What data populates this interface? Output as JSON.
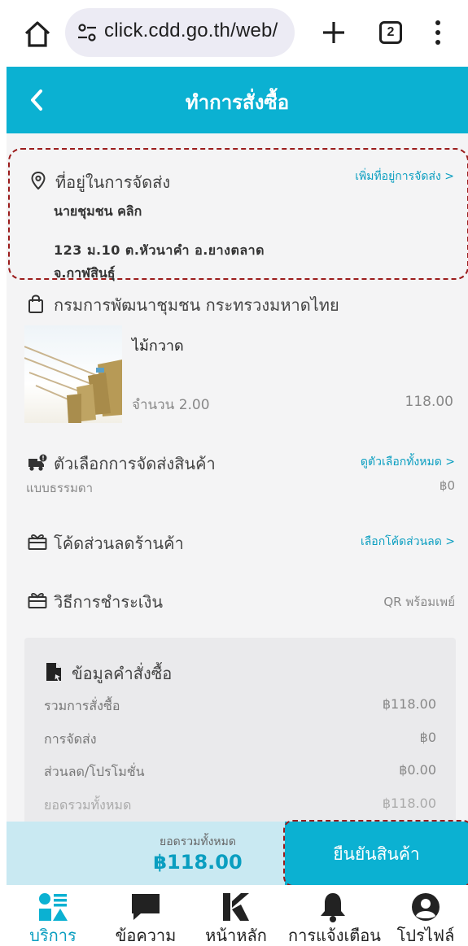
{
  "browser": {
    "url": "click.cdd.go.th/web/",
    "tab_count": "2"
  },
  "header": {
    "title": "ทำการสั่งซื้อ"
  },
  "address": {
    "label": "ที่อยู่ในการจัดส่ง",
    "add_link": "เพิ่มที่อยู่การจัดส่ง >",
    "recipient": "นายชุมชน คลิก",
    "line1": "123 ม.10 ต.หัวนาคำ อ.ยางตลาด",
    "line2": "จ.กาฬสินธุ์"
  },
  "shop": {
    "name": "กรมการพัฒนาชุมชน กระทรวงมหาดไทย"
  },
  "product": {
    "name": "ไม้กวาด",
    "quantity": "จำนวน 2.00",
    "price": "118.00"
  },
  "shipping": {
    "label": "ตัวเลือกการจัดส่งสินค้า",
    "link": "ดูตัวเลือกทั้งหมด >",
    "method": "แบบธรรมดา",
    "cost": "฿0"
  },
  "coupon": {
    "label": "โค้ดส่วนลดร้านค้า",
    "link": "เลือกโค้ดส่วนลด >"
  },
  "payment": {
    "label": "วิธีการชำระเงิน",
    "value": "QR พร้อมเพย์"
  },
  "summary": {
    "title": "ข้อมูลคำสั่งซื้อ",
    "rows": [
      {
        "label": "รวมการสั่งซื้อ",
        "value": "฿118.00"
      },
      {
        "label": "การจัดส่ง",
        "value": "฿0"
      },
      {
        "label": "ส่วนลด/โปรโมชั่น",
        "value": "฿0.00"
      },
      {
        "label": "ยอดรวมทั้งหมด",
        "value": "฿118.00"
      }
    ]
  },
  "checkout": {
    "total_label": "ยอดรวมทั้งหมด",
    "total_value": "฿118.00",
    "confirm_label": "ยืนยันสินค้า"
  },
  "nav": {
    "items": [
      {
        "label": "บริการ",
        "icon": "services-icon",
        "active": true
      },
      {
        "label": "ข้อความ",
        "icon": "chat-icon",
        "active": false
      },
      {
        "label": "หน้าหลัก",
        "icon": "home-logo-icon",
        "active": false
      },
      {
        "label": "การแจ้งเตือน",
        "icon": "bell-icon",
        "active": false
      },
      {
        "label": "โปรไฟล์",
        "icon": "profile-icon",
        "active": false
      }
    ]
  },
  "colors": {
    "accent": "#0bb1d2",
    "link": "#0a9ec0",
    "background": "#f4f4f5"
  }
}
